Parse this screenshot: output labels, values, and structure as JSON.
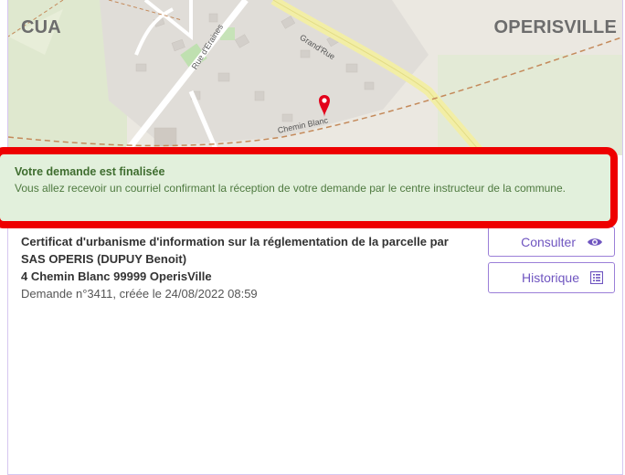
{
  "map": {
    "left_title": "CUA",
    "right_title": "OPERISVILLE",
    "streets": [
      "Rue d'Eraines",
      "Grand'Rue",
      "Chemin Blanc"
    ]
  },
  "alert": {
    "title": "Votre demande est finalisée",
    "message": "Vous allez recevoir un courriel confirmant la réception de votre demande par le centre instructeur de la commune."
  },
  "request": {
    "title": "Certificat d'urbanisme d'information sur la réglementation de la parcelle par SAS OPERIS (DUPUY Benoit)",
    "address": "4 Chemin Blanc 99999 OperisVille",
    "meta": "Demande n°3411, créée le 24/08/2022 08:59"
  },
  "actions": {
    "consulter_label": "Consulter",
    "historique_label": "Historique"
  },
  "colors": {
    "accent": "#6f55c0",
    "alert_bg": "#e2f0dc",
    "alert_border": "#ee0000",
    "marker": "#e3001b"
  },
  "icons": {
    "consulter": "eye-icon",
    "historique": "list-icon",
    "marker": "map-marker-icon"
  }
}
